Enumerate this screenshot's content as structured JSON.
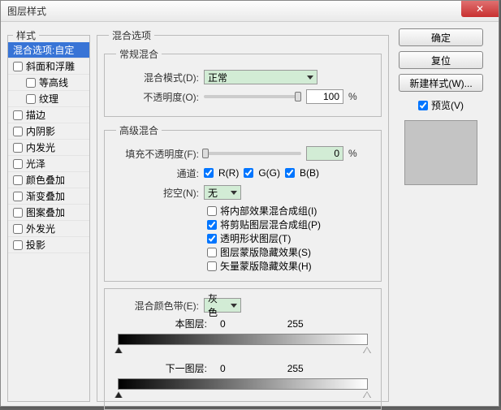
{
  "window": {
    "title": "图层样式",
    "close": "✕"
  },
  "styles": {
    "legend": "样式",
    "items": [
      {
        "label": "混合选项:自定",
        "selected": true,
        "checkbox": false,
        "indent": 0
      },
      {
        "label": "斜面和浮雕",
        "selected": false,
        "checkbox": true,
        "checked": false,
        "indent": 0
      },
      {
        "label": "等高线",
        "selected": false,
        "checkbox": true,
        "checked": false,
        "indent": 1
      },
      {
        "label": "纹理",
        "selected": false,
        "checkbox": true,
        "checked": false,
        "indent": 1
      },
      {
        "label": "描边",
        "selected": false,
        "checkbox": true,
        "checked": false,
        "indent": 0
      },
      {
        "label": "内阴影",
        "selected": false,
        "checkbox": true,
        "checked": false,
        "indent": 0
      },
      {
        "label": "内发光",
        "selected": false,
        "checkbox": true,
        "checked": false,
        "indent": 0
      },
      {
        "label": "光泽",
        "selected": false,
        "checkbox": true,
        "checked": false,
        "indent": 0
      },
      {
        "label": "颜色叠加",
        "selected": false,
        "checkbox": true,
        "checked": false,
        "indent": 0
      },
      {
        "label": "渐变叠加",
        "selected": false,
        "checkbox": true,
        "checked": false,
        "indent": 0
      },
      {
        "label": "图案叠加",
        "selected": false,
        "checkbox": true,
        "checked": false,
        "indent": 0
      },
      {
        "label": "外发光",
        "selected": false,
        "checkbox": true,
        "checked": false,
        "indent": 0
      },
      {
        "label": "投影",
        "selected": false,
        "checkbox": true,
        "checked": false,
        "indent": 0
      }
    ]
  },
  "blend_options": {
    "legend": "混合选项",
    "general": {
      "legend": "常规混合",
      "mode_label": "混合模式(D):",
      "mode_value": "正常",
      "opacity_label": "不透明度(O):",
      "opacity_value": "100",
      "pct": "%"
    },
    "advanced": {
      "legend": "高级混合",
      "fill_label": "填充不透明度(F):",
      "fill_value": "0",
      "pct": "%",
      "channel_label": "通道:",
      "ch_r": "R(R)",
      "ch_g": "G(G)",
      "ch_b": "B(B)",
      "knockout_label": "挖空(N):",
      "knockout_value": "无",
      "opts": [
        {
          "label": "将内部效果混合成组(I)",
          "checked": false
        },
        {
          "label": "将剪贴图层混合成组(P)",
          "checked": true
        },
        {
          "label": "透明形状图层(T)",
          "checked": true
        },
        {
          "label": "图层蒙版隐藏效果(S)",
          "checked": false
        },
        {
          "label": "矢量蒙版隐藏效果(H)",
          "checked": false
        }
      ]
    },
    "blendif": {
      "label": "混合颜色带(E):",
      "value": "灰色",
      "this_label": "本图层:",
      "this_lo": "0",
      "this_hi": "255",
      "next_label": "下一图层:",
      "next_lo": "0",
      "next_hi": "255"
    }
  },
  "buttons": {
    "ok": "确定",
    "reset": "复位",
    "newstyle": "新建样式(W)...",
    "preview": "预览(V)"
  }
}
